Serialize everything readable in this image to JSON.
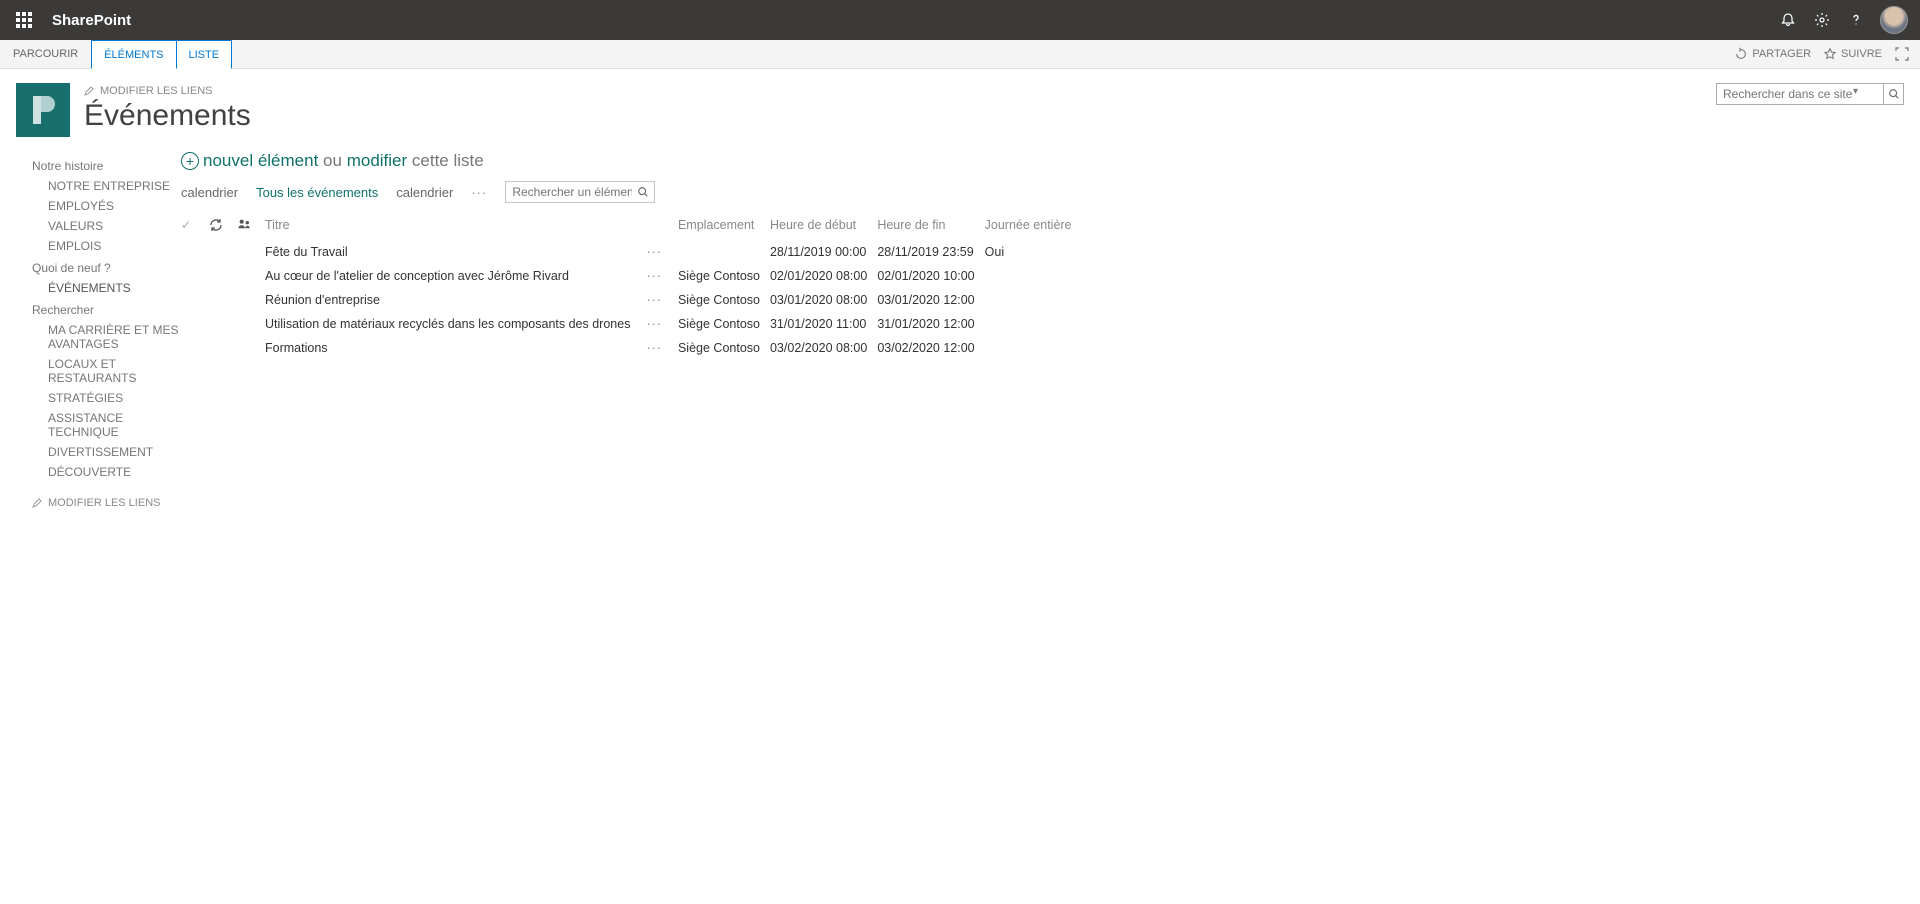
{
  "suite": {
    "brand": "SharePoint"
  },
  "ribbon": {
    "tabs": {
      "browse": "PARCOURIR",
      "items": "ÉLÉMENTS",
      "list": "LISTE"
    },
    "actions": {
      "share": "PARTAGER",
      "follow": "SUIVRE"
    }
  },
  "header": {
    "edit_links": "MODIFIER LES LIENS",
    "title": "Événements",
    "search_placeholder": "Rechercher dans ce site"
  },
  "nav": {
    "group1": {
      "heading": "Notre histoire",
      "items": [
        "NOTRE ENTREPRISE",
        "EMPLOYÉS",
        "VALEURS",
        "EMPLOIS"
      ]
    },
    "group2": {
      "heading": "Quoi de neuf ?",
      "items": [
        "ÉVÉNEMENTS"
      ]
    },
    "group3": {
      "heading": "Rechercher",
      "items": [
        "MA CARRIÈRE ET MES AVANTAGES",
        "LOCAUX ET RESTAURANTS",
        "STRATÉGIES",
        "ASSISTANCE TECHNIQUE",
        "DIVERTISSEMENT",
        "DÉCOUVERTE"
      ]
    },
    "edit_links": "MODIFIER LES LIENS"
  },
  "list": {
    "new_item": "nouvel élément",
    "or": "ou",
    "edit": "modifier",
    "this_list": "cette liste",
    "views": {
      "v1": "calendrier",
      "v2": "Tous les événements",
      "v3": "calendrier"
    },
    "search_placeholder": "Rechercher un élément",
    "columns": {
      "title": "Titre",
      "location": "Emplacement",
      "start": "Heure de début",
      "end": "Heure de fin",
      "allday": "Journée entière"
    },
    "rows": [
      {
        "title": "Fête du Travail",
        "location": "",
        "start": "28/11/2019 00:00",
        "end": "28/11/2019 23:59",
        "allday": "Oui"
      },
      {
        "title": "Au cœur de l'atelier de conception avec Jérôme Rivard",
        "location": "Siège Contoso",
        "start": "02/01/2020 08:00",
        "end": "02/01/2020 10:00",
        "allday": ""
      },
      {
        "title": "Réunion d'entreprise",
        "location": "Siège Contoso",
        "start": "03/01/2020 08:00",
        "end": "03/01/2020 12:00",
        "allday": ""
      },
      {
        "title": "Utilisation de matériaux recyclés dans les composants des drones",
        "location": "Siège Contoso",
        "start": "31/01/2020 11:00",
        "end": "31/01/2020 12:00",
        "allday": ""
      },
      {
        "title": "Formations",
        "location": "Siège Contoso",
        "start": "03/02/2020 08:00",
        "end": "03/02/2020 12:00",
        "allday": ""
      }
    ]
  }
}
